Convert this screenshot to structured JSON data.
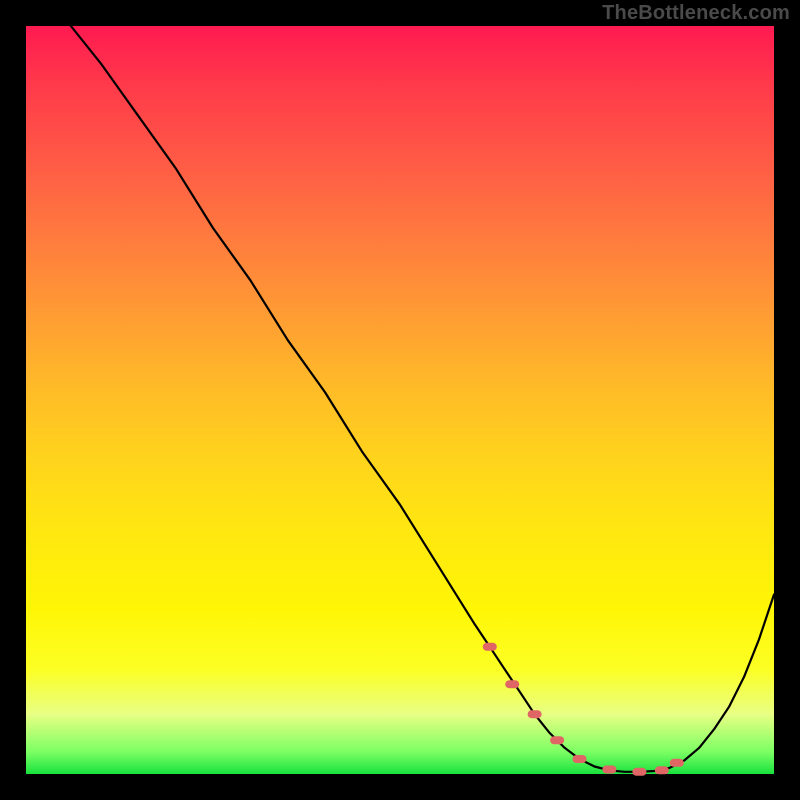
{
  "watermark": "TheBottleneck.com",
  "chart_data": {
    "type": "line",
    "title": "",
    "xlabel": "",
    "ylabel": "",
    "xlim": [
      0,
      100
    ],
    "ylim": [
      0,
      100
    ],
    "grid": false,
    "legend": false,
    "series": [
      {
        "name": "bottleneck-curve",
        "x": [
          6,
          10,
          15,
          20,
          25,
          30,
          35,
          40,
          45,
          50,
          55,
          60,
          62,
          64,
          66,
          68,
          70,
          72,
          74,
          76,
          78,
          80,
          82,
          84,
          86,
          88,
          90,
          92,
          94,
          96,
          98,
          100
        ],
        "y": [
          100,
          95,
          88,
          81,
          73,
          66,
          58,
          51,
          43,
          36,
          28,
          20,
          17,
          14,
          11,
          8,
          5.5,
          3.5,
          2,
          1,
          0.5,
          0.3,
          0.3,
          0.4,
          0.8,
          1.8,
          3.5,
          6,
          9,
          13,
          18,
          24
        ]
      }
    ],
    "markers": {
      "name": "highlight-segment",
      "color": "#e06666",
      "x": [
        62,
        65,
        68,
        71,
        74,
        78,
        82,
        85,
        87
      ],
      "y": [
        17,
        12,
        8,
        4.5,
        2,
        0.6,
        0.3,
        0.5,
        1.5
      ]
    }
  }
}
